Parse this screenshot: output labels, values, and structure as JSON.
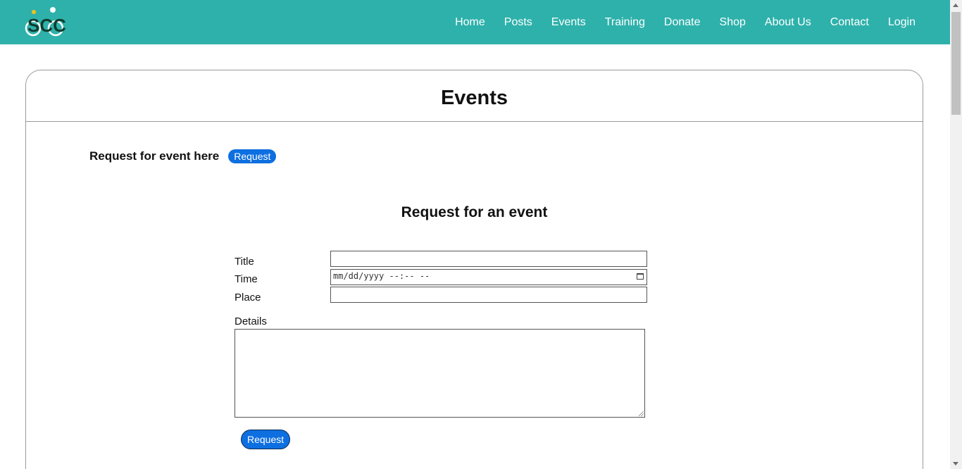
{
  "brand": {
    "logo_text": "SCC",
    "accent": "#2eb1ab"
  },
  "nav": {
    "items": [
      "Home",
      "Posts",
      "Events",
      "Training",
      "Donate",
      "Shop",
      "About Us",
      "Contact",
      "Login"
    ]
  },
  "page": {
    "title": "Events",
    "request_prompt": "Request for event here",
    "request_button": "Request"
  },
  "form": {
    "title": "Request for an event",
    "title_label": "Title",
    "time_label": "Time",
    "time_placeholder": "mm/dd/yyyy --:-- --",
    "place_label": "Place",
    "details_label": "Details",
    "submit_label": "Request",
    "button_color": "#0d6fe0"
  }
}
